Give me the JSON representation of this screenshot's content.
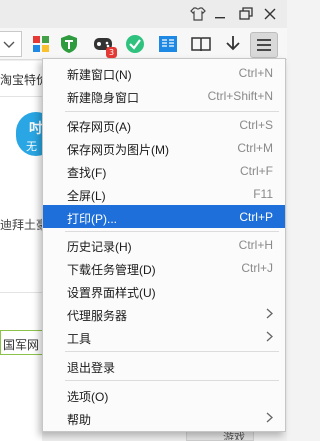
{
  "menu": {
    "items": [
      {
        "label": "新建窗口(N)",
        "shortcut": "Ctrl+N"
      },
      {
        "label": "新建隐身窗口",
        "shortcut": "Ctrl+Shift+N"
      },
      {
        "label": "保存网页(A)",
        "shortcut": "Ctrl+S"
      },
      {
        "label": "保存网页为图片(M)",
        "shortcut": "Ctrl+M"
      },
      {
        "label": "查找(F)",
        "shortcut": "Ctrl+F"
      },
      {
        "label": "全屏(L)",
        "shortcut": "F11"
      },
      {
        "label": "打印(P)...",
        "shortcut": "Ctrl+P"
      },
      {
        "label": "历史记录(H)",
        "shortcut": "Ctrl+H"
      },
      {
        "label": "下载任务管理(D)",
        "shortcut": "Ctrl+J"
      },
      {
        "label": "设置界面样式(U)",
        "shortcut": ""
      },
      {
        "label": "代理服务器",
        "shortcut": ""
      },
      {
        "label": "工具",
        "shortcut": ""
      },
      {
        "label": "退出登录",
        "shortcut": ""
      },
      {
        "label": "选项(O)",
        "shortcut": ""
      },
      {
        "label": "帮助",
        "shortcut": ""
      }
    ],
    "highlighted_item": "打印(P)...",
    "highlight_color": "#1e6fd9"
  },
  "toolbar": {
    "badge_count": "3"
  },
  "page_fragments": {
    "text_1": "淘宝特价",
    "text_2": "吋",
    "text_3": "无",
    "text_4": "迪拜土豪",
    "text_5": "国军网",
    "text_6": "游戏"
  }
}
